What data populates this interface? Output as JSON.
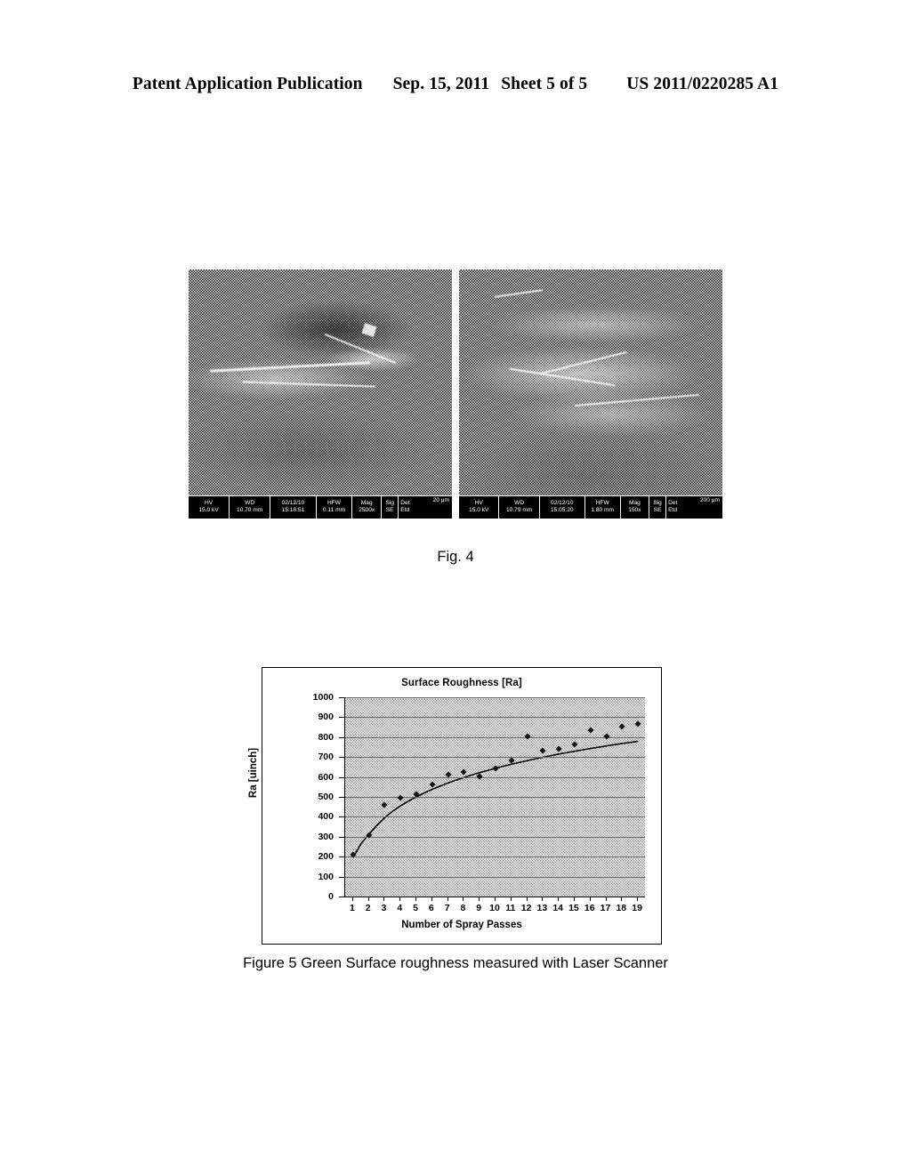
{
  "header": {
    "publication": "Patent Application Publication",
    "date": "Sep. 15, 2011",
    "sheet": "Sheet 5 of 5",
    "publication_number": "US 2011/0220285 A1"
  },
  "figure4": {
    "caption": "Fig. 4",
    "images": [
      {
        "position": "left",
        "databar": {
          "hv_label": "HV",
          "hv_value": "15.0 kV",
          "wd_label": "WD",
          "wd_value": "10.70 mm",
          "date_label": "02/12/10",
          "time_value": "15:18:51",
          "hfw_label": "HFW",
          "hfw_value": "0.11 mm",
          "mag_label": "Mag",
          "mag_value": "2500x",
          "sig_label": "Sig",
          "sig_value": "SE",
          "det_label": "Det",
          "det_value": "Etd",
          "scale_value": "20 µm"
        }
      },
      {
        "position": "right",
        "databar": {
          "hv_label": "HV",
          "hv_value": "15.0 kV",
          "wd_label": "WD",
          "wd_value": "10.79 mm",
          "date_label": "02/12/10",
          "time_value": "15:05:20",
          "hfw_label": "HFW",
          "hfw_value": "1.80 mm",
          "mag_label": "Mag",
          "mag_value": "150x",
          "sig_label": "Sig",
          "sig_value": "SE",
          "det_label": "Det",
          "det_value": "Etd",
          "scale_value": "200 µm"
        }
      }
    ]
  },
  "figure5": {
    "caption": "Figure 5 Green Surface roughness measured with Laser Scanner"
  },
  "chart_data": {
    "type": "scatter",
    "title": "Surface Roughness [Ra]",
    "xlabel": "Number of Spray Passes",
    "ylabel": "Ra [uinch]",
    "x": [
      1,
      2,
      3,
      4,
      5,
      6,
      7,
      8,
      9,
      10,
      11,
      12,
      13,
      14,
      15,
      16,
      17,
      18,
      19
    ],
    "values": [
      210,
      310,
      460,
      497,
      512,
      562,
      612,
      625,
      603,
      645,
      683,
      803,
      733,
      742,
      763,
      837,
      805,
      852,
      868
    ],
    "xtick_labels": [
      "1",
      "2",
      "3",
      "4",
      "5",
      "6",
      "7",
      "8",
      "9",
      "10",
      "11",
      "12",
      "13",
      "14",
      "15",
      "16",
      "17",
      "18",
      "19"
    ],
    "ytick_labels": [
      "1000",
      "900",
      "800",
      "700",
      "600",
      "500",
      "400",
      "300",
      "200",
      "100",
      "0"
    ],
    "yticks": [
      1000,
      900,
      800,
      700,
      600,
      500,
      400,
      300,
      200,
      100,
      0
    ],
    "ylim": [
      0,
      1000
    ],
    "xlim": [
      0.5,
      19.5
    ],
    "grid": true,
    "legend": false,
    "trendline": {
      "type": "logarithmic",
      "points": [
        [
          1,
          195
        ],
        [
          1.5,
          265
        ],
        [
          2,
          312
        ],
        [
          2.5,
          357
        ],
        [
          3,
          396
        ],
        [
          3.5,
          428
        ],
        [
          4,
          455
        ],
        [
          4.5,
          479
        ],
        [
          5,
          500
        ],
        [
          5.5,
          520
        ],
        [
          6,
          538
        ],
        [
          6.5,
          554
        ],
        [
          7,
          570
        ],
        [
          7.5,
          584
        ],
        [
          8,
          597
        ],
        [
          8.5,
          610
        ],
        [
          9,
          622
        ],
        [
          9.5,
          633
        ],
        [
          10,
          644
        ],
        [
          10.5,
          654
        ],
        [
          11,
          664
        ],
        [
          11.5,
          673
        ],
        [
          12,
          682
        ],
        [
          12.5,
          691
        ],
        [
          13,
          699
        ],
        [
          13.5,
          707
        ],
        [
          14,
          715
        ],
        [
          14.5,
          722
        ],
        [
          15,
          729
        ],
        [
          15.5,
          736
        ],
        [
          16,
          743
        ],
        [
          16.5,
          749
        ],
        [
          17,
          756
        ],
        [
          17.5,
          762
        ],
        [
          18,
          768
        ],
        [
          18.5,
          773
        ],
        [
          19,
          779
        ]
      ]
    }
  }
}
